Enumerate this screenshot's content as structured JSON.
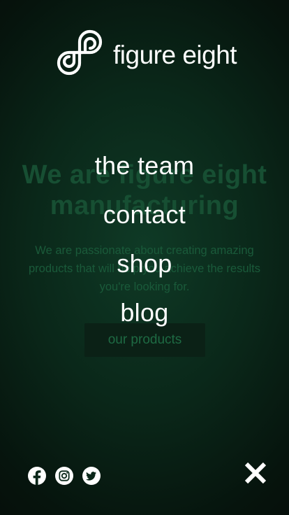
{
  "brand": {
    "name": "figure eight",
    "logo_icon": "figure-eight-logo-icon"
  },
  "background": {
    "hero_title": "We are figure eight manufacturing",
    "hero_subtitle": "We are passionate about creating amazing products that will help you achieve the results you're looking for.",
    "cta_label": "our products"
  },
  "menu": {
    "items": [
      {
        "label": "the team"
      },
      {
        "label": "contact"
      },
      {
        "label": "shop"
      },
      {
        "label": "blog"
      }
    ]
  },
  "socials": [
    {
      "name": "facebook",
      "icon": "facebook-icon"
    },
    {
      "name": "instagram",
      "icon": "instagram-icon"
    },
    {
      "name": "twitter",
      "icon": "twitter-icon"
    }
  ],
  "close": {
    "icon": "close-icon"
  },
  "colors": {
    "background": "#0a2719",
    "text": "#ffffff",
    "dimmed_text": "#174f33"
  }
}
